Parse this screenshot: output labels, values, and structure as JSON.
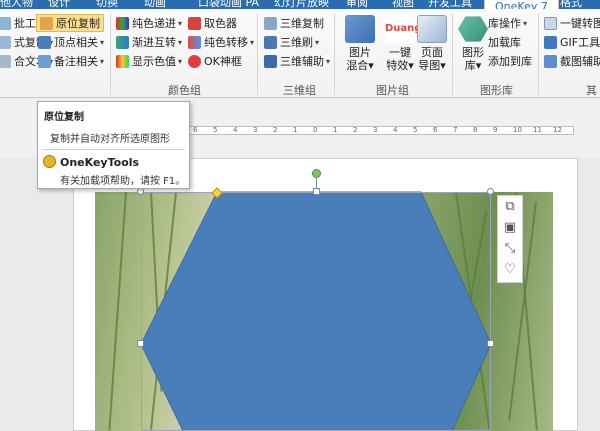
{
  "tabs": [
    {
      "label": "他人物",
      "active": false
    },
    {
      "label": "设计",
      "active": false
    },
    {
      "label": "切换",
      "active": false
    },
    {
      "label": "动画",
      "active": false
    },
    {
      "label": "口袋动画 PA",
      "active": false
    },
    {
      "label": "幻灯片放映",
      "active": false
    },
    {
      "label": "审阅",
      "active": false
    },
    {
      "label": "视图",
      "active": false
    },
    {
      "label": "开发工具",
      "active": false
    },
    {
      "label": "OneKey 7",
      "active": true
    },
    {
      "label": "格式",
      "active": false
    }
  ],
  "ribbon": {
    "col1": [
      "批工具",
      "式复制",
      "合文本"
    ],
    "col2": [
      "原位复制",
      "顶点相关",
      "备注相关"
    ],
    "color_group": {
      "items": [
        "纯色递进",
        "渐进互转",
        "显示色值",
        "取色器",
        "纯色转移",
        "OK神框"
      ],
      "label": "颜色组"
    },
    "three_d_group": {
      "items": [
        "三维复制",
        "三维刷",
        "三维辅助"
      ],
      "label": "三维组"
    },
    "image_group": {
      "items": [
        {
          "top": "图片",
          "bottom": "混合"
        },
        {
          "top": "一键",
          "bottom": "特效"
        },
        {
          "top": "页面",
          "bottom": "导图"
        }
      ],
      "duang": "Duang",
      "label": "图片组"
    },
    "gallery_group": {
      "big": {
        "top": "图形",
        "bottom": "库"
      },
      "items": [
        "库操作",
        "加载库",
        "添加到库"
      ],
      "label": "图形库"
    },
    "extra_group": {
      "items": [
        "一键转图",
        "GIF工具",
        "截图辅助"
      ],
      "label": "其"
    }
  },
  "ruler": [
    "6",
    "5",
    "4",
    "3",
    "2",
    "1",
    "0",
    "1",
    "2",
    "3",
    "4",
    "5",
    "6",
    "7",
    "8",
    "9",
    "10",
    "11",
    "12"
  ],
  "tooltip": {
    "title": "原位复制",
    "description": "复制并自动对齐所选原图形",
    "addin": "OneKeyTools",
    "help": "有关加载项帮助，请按 F1。"
  },
  "colors": {
    "hexagon": "#4a7ebb",
    "tab_bar": "#2b6cb0",
    "highlight": "#fcdf8e"
  }
}
